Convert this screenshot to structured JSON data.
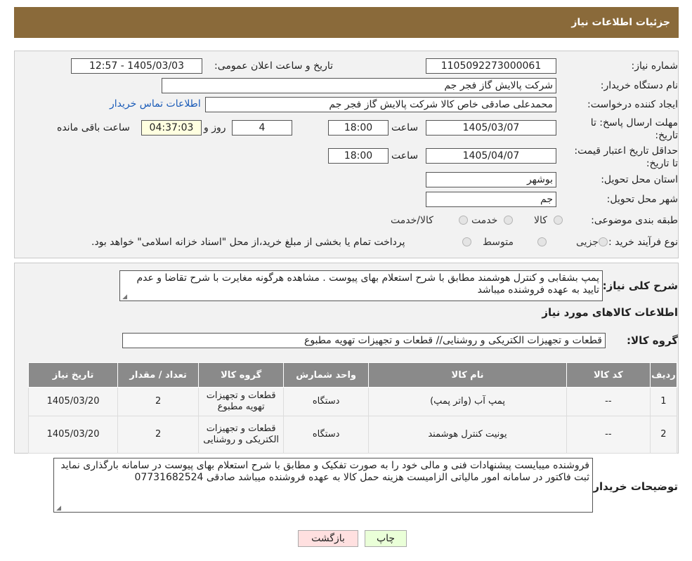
{
  "header": {
    "title": "جزئیات اطلاعات نیاز"
  },
  "info": {
    "need_number_label": "شماره نیاز:",
    "need_number": "1105092273000061",
    "announce_label": "تاریخ و ساعت اعلان عمومی:",
    "announce_value": "1405/03/03 - 12:57",
    "buyer_org_label": "نام دستگاه خریدار:",
    "buyer_org": "شرکت پالایش گاز فجر جم",
    "requester_label": "ایجاد کننده درخواست:",
    "requester": "محمدعلی صادقی خاص کالا شرکت پالایش گاز فجر جم",
    "contact_link": "اطلاعات تماس خریدار",
    "deadline_label": "مهلت ارسال پاسخ: تا تاریخ:",
    "deadline_date": "1405/03/07",
    "time_label": "ساعت",
    "deadline_time": "18:00",
    "days": "4",
    "days_label": "روز و",
    "remaining": "04:37:03",
    "remaining_label": "ساعت باقی مانده",
    "validity_label": "حداقل تاریخ اعتبار قیمت: تا تاریخ:",
    "validity_date": "1405/04/07",
    "validity_time": "18:00",
    "province_label": "استان محل تحویل:",
    "province": "بوشهر",
    "city_label": "شهر محل تحویل:",
    "city": "جم",
    "category_label": "طبقه بندی موضوعی:",
    "category_options": [
      "کالا",
      "خدمت",
      "کالا/خدمت"
    ],
    "process_label": "نوع فرآیند خرید :",
    "process_options": [
      "جزیی",
      "متوسط"
    ],
    "process_note": "پرداخت تمام یا بخشی از مبلغ خرید،از محل \"اسناد خزانه اسلامی\" خواهد بود."
  },
  "summary": {
    "label": "شرح کلی نیاز:",
    "text": "پمپ بشقابی و کنترل هوشمند مطابق با شرح استعلام بهای پیوست . مشاهده هرگونه مغایرت با شرح تقاضا و عدم تایید به عهده فروشنده میباشد",
    "goods_title": "اطلاعات کالاهای مورد نیاز",
    "group_label": "گروه کالا:",
    "group_value": "قطعات و تجهیزات الکتریکی و روشنایی//  قطعات و تجهیزات تهویه مطبوع"
  },
  "table": {
    "headers": [
      "ردیف",
      "کد کالا",
      "نام کالا",
      "واحد شمارش",
      "گروه کالا",
      "تعداد / مقدار",
      "تاریخ نیاز"
    ],
    "rows": [
      {
        "row": "1",
        "code": "--",
        "name": "پمپ آب (واتر پمپ)",
        "unit": "دستگاه",
        "group": "قطعات و تجهیزات تهویه مطبوع",
        "qty": "2",
        "date": "1405/03/20"
      },
      {
        "row": "2",
        "code": "--",
        "name": "یونیت کنترل هوشمند",
        "unit": "دستگاه",
        "group": "قطعات و تجهیزات الکتریکی و روشنایی",
        "qty": "2",
        "date": "1405/03/20"
      }
    ]
  },
  "buyer_notes": {
    "label": "توضیحات خریدار:",
    "text": "فروشنده میبایست پیشنهادات فنی و مالی خود را به صورت تفکیک و مطابق با شرح استعلام بهای پیوست در سامانه بارگذاری نماید ثبت فاکتور در سامانه امور مالیاتی الزامیست هزینه حمل کالا به عهده فروشنده میباشد صادقی 07731682524"
  },
  "buttons": {
    "print": "چاپ",
    "back": "بازگشت"
  },
  "colors": {
    "header_bg": "#8a6a3a",
    "table_header_bg": "#8a8a8a",
    "print_bg": "#eaffd8",
    "back_bg": "#ffe0e0",
    "link": "#1a5bb8"
  }
}
